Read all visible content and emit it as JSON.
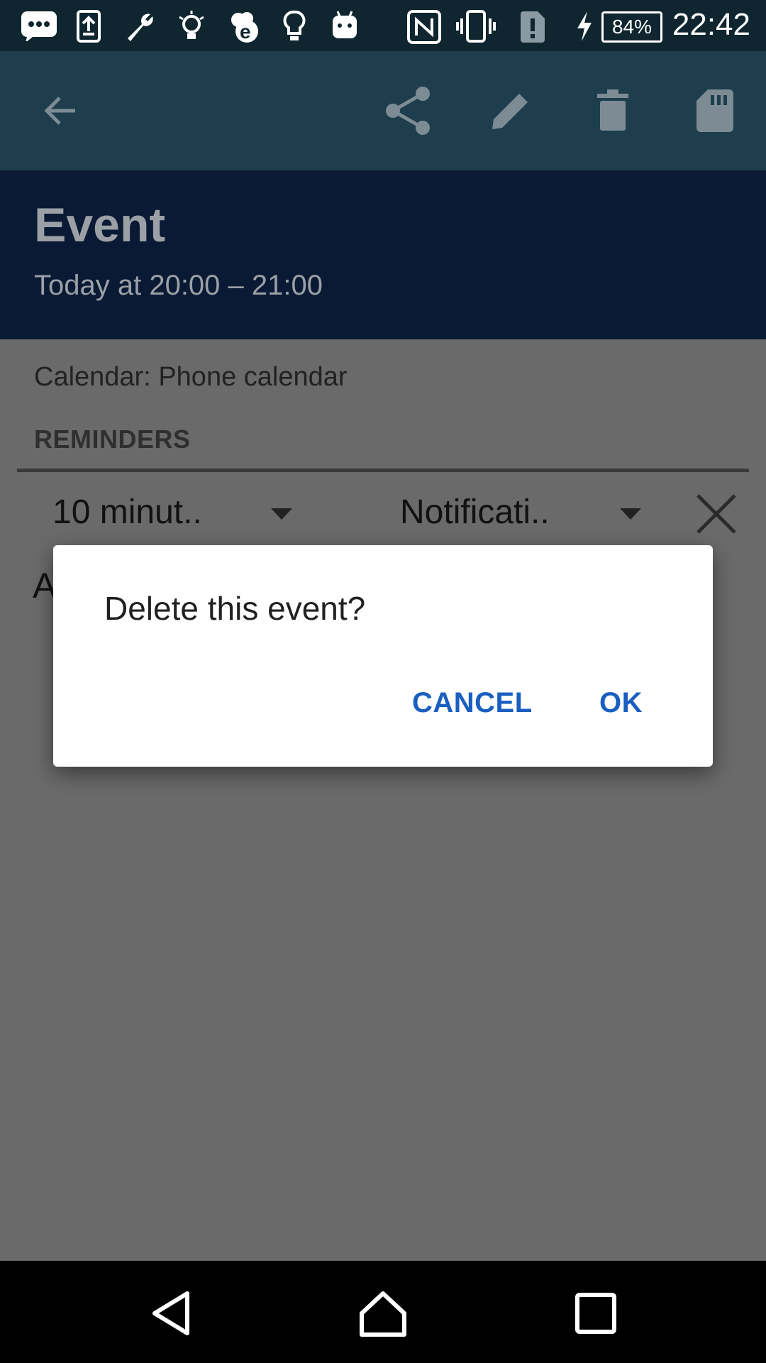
{
  "status_bar": {
    "battery_percent": "84%",
    "time": "22:42",
    "icons": [
      "message-icon",
      "upload-icon",
      "wrench-icon",
      "bulb-outline-icon",
      "chef-e-icon",
      "bulb-icon",
      "android-icon",
      "nfc-icon",
      "vibrate-icon",
      "sim-alert-icon",
      "charging-icon",
      "battery-icon"
    ]
  },
  "app_bar": {
    "back_icon": "arrow-left-icon",
    "actions": [
      "share-icon",
      "edit-icon",
      "delete-icon",
      "sd-card-icon"
    ]
  },
  "event": {
    "title": "Event",
    "time_range": "Today at 20:00 – 21:00"
  },
  "details": {
    "calendar_label": "Calendar:",
    "calendar_value": "Phone calendar",
    "reminders_header": "REMINDERS",
    "reminder_time": "10 minut..",
    "reminder_method": "Notificati..",
    "obscured_letter": "A"
  },
  "dialog": {
    "message": "Delete this event?",
    "cancel_label": "CANCEL",
    "ok_label": "OK",
    "button_color": "#1a5fc0"
  },
  "nav_bar": {
    "buttons": [
      "back-triangle-icon",
      "home-icon",
      "recents-icon"
    ]
  }
}
